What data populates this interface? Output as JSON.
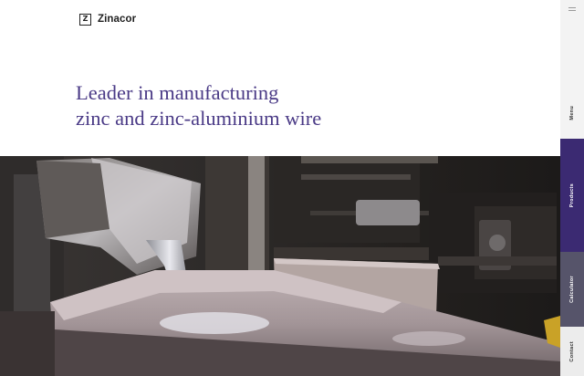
{
  "brand": {
    "logo_letter": "Z",
    "name": "Zinacor"
  },
  "hero": {
    "headline_line1": "Leader in manufacturing",
    "headline_line2": "zinc and zinc-aluminium wire"
  },
  "rail": {
    "menu_label": "Menu",
    "items": [
      {
        "label": "Products"
      },
      {
        "label": "Calculator"
      },
      {
        "label": "Contact"
      }
    ]
  },
  "colors": {
    "accent": "#4a3a86",
    "products_bg": "#3b2a72",
    "calculator_bg": "#56546a"
  },
  "icons": {
    "menu": "hamburger-icon"
  }
}
